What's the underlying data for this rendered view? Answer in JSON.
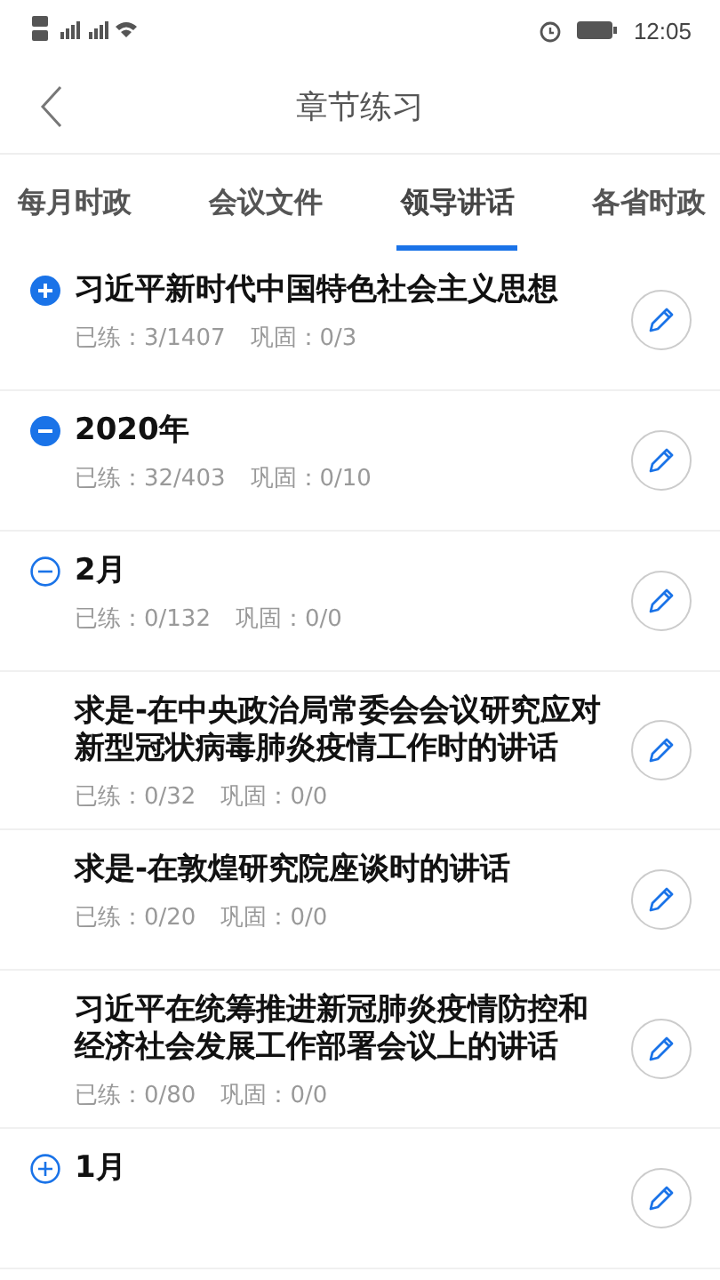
{
  "status_bar": {
    "time": "12:05"
  },
  "header": {
    "title": "章节练习"
  },
  "tabs": [
    {
      "label": "每月时政",
      "selected": false
    },
    {
      "label": "会议文件",
      "selected": false
    },
    {
      "label": "领导讲话",
      "selected": true
    },
    {
      "label": "各省时政",
      "selected": false
    }
  ],
  "chapters": [
    {
      "title": "习近平新时代中国特色社会主义思想",
      "practiced": "已练：3/1407",
      "consolidated": "巩固：0/3",
      "expanded": false
    },
    {
      "title": "2020年",
      "practiced": "已练：32/403",
      "consolidated": "巩固：0/10",
      "expanded": true,
      "children": [
        {
          "title": "2月",
          "practiced": "已练：0/132",
          "consolidated": "巩固：0/0",
          "expanded": true,
          "children": [
            {
              "title": "求是-在中央政治局常委会会议研究应对新型冠状病毒肺炎疫情工作时的讲话",
              "practiced": "已练：0/32",
              "consolidated": "巩固：0/0"
            },
            {
              "title": "求是-在敦煌研究院座谈时的讲话",
              "practiced": "已练：0/20",
              "consolidated": "巩固：0/0"
            },
            {
              "title": "习近平在统筹推进新冠肺炎疫情防控和经济社会发展工作部署会议上的讲话",
              "practiced": "已练：0/80",
              "consolidated": "巩固：0/0"
            }
          ]
        },
        {
          "title": "1月",
          "expanded": false
        }
      ]
    }
  ]
}
